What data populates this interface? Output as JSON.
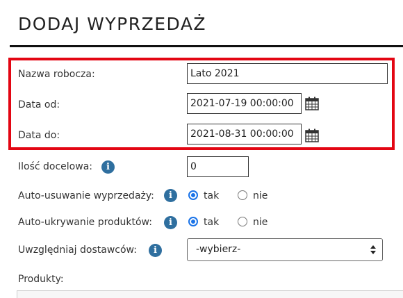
{
  "page": {
    "title": "DODAJ WYPRZEDAŻ"
  },
  "form": {
    "working_name": {
      "label": "Nazwa robocza:",
      "value": "Lato 2021"
    },
    "date_from": {
      "label": "Data od:",
      "value": "2021-07-19 00:00:00",
      "icon": "calendar-icon"
    },
    "date_to": {
      "label": "Data do:",
      "value": "2021-08-31 00:00:00",
      "icon": "calendar-icon"
    },
    "target_quantity": {
      "label": "Ilość docelowa:",
      "value": "0",
      "icon": "info-icon"
    },
    "auto_remove_sale": {
      "label": "Auto-usuwanie wyprzedaży:",
      "icon": "info-icon",
      "options": [
        "tak",
        "nie"
      ],
      "selected": "tak"
    },
    "auto_hide_products": {
      "label": "Auto-ukrywanie produktów:",
      "icon": "info-icon",
      "options": [
        "tak",
        "nie"
      ],
      "selected": "tak"
    },
    "include_suppliers": {
      "label": "Uwzględniaj dostawców:",
      "icon": "info-icon",
      "selected": "-wybierz-"
    },
    "products": {
      "label": "Produkty:"
    }
  },
  "colors": {
    "highlight": "#e30613",
    "info": "#2f6f9f",
    "radio_selected": "#1a73e8"
  }
}
